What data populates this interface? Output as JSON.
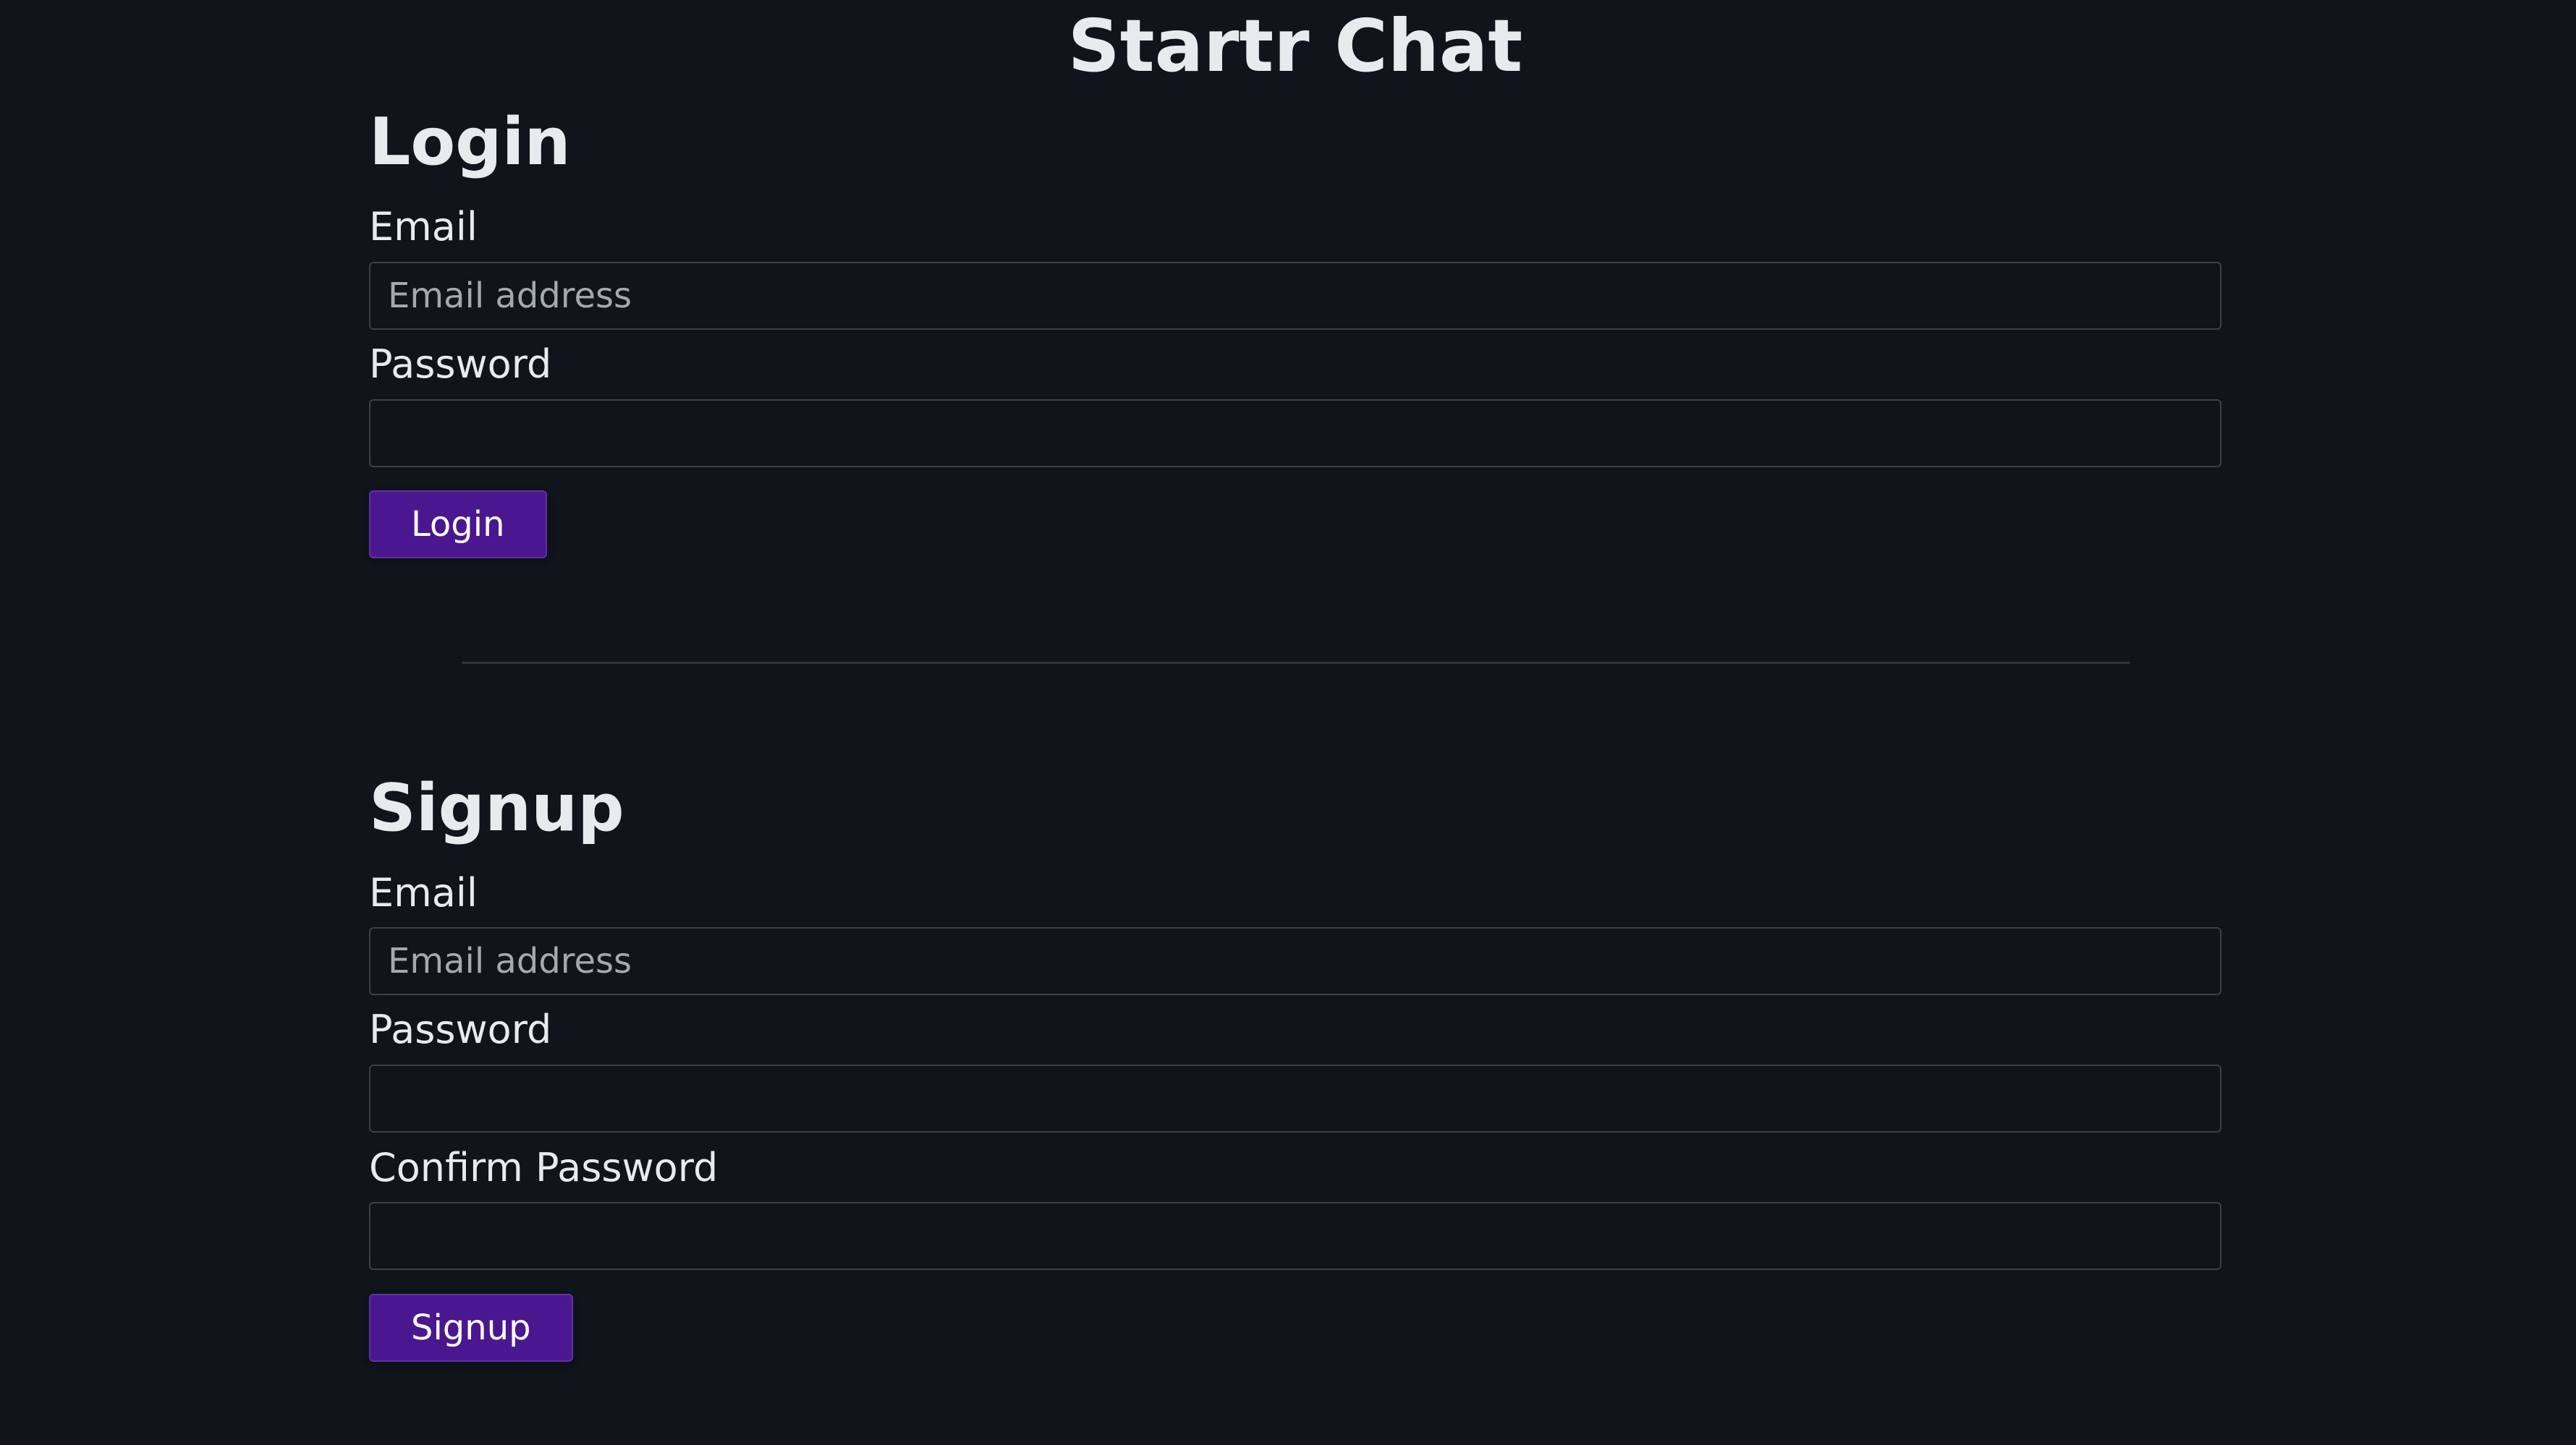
{
  "app": {
    "title": "Startr Chat"
  },
  "login": {
    "title": "Login",
    "email_label": "Email",
    "email_placeholder": "Email address",
    "email_value": "",
    "password_label": "Password",
    "password_value": "",
    "button_label": "Login"
  },
  "signup": {
    "title": "Signup",
    "email_label": "Email",
    "email_placeholder": "Email address",
    "email_value": "",
    "password_label": "Password",
    "password_value": "",
    "confirm_password_label": "Confirm Password",
    "confirm_password_value": "",
    "button_label": "Signup"
  },
  "colors": {
    "background": "#10141b",
    "text": "#e8ebee",
    "input_border": "#3b414a",
    "placeholder": "#a3a9b1",
    "button_accent": "#4a1791",
    "divider": "#2f353d"
  }
}
